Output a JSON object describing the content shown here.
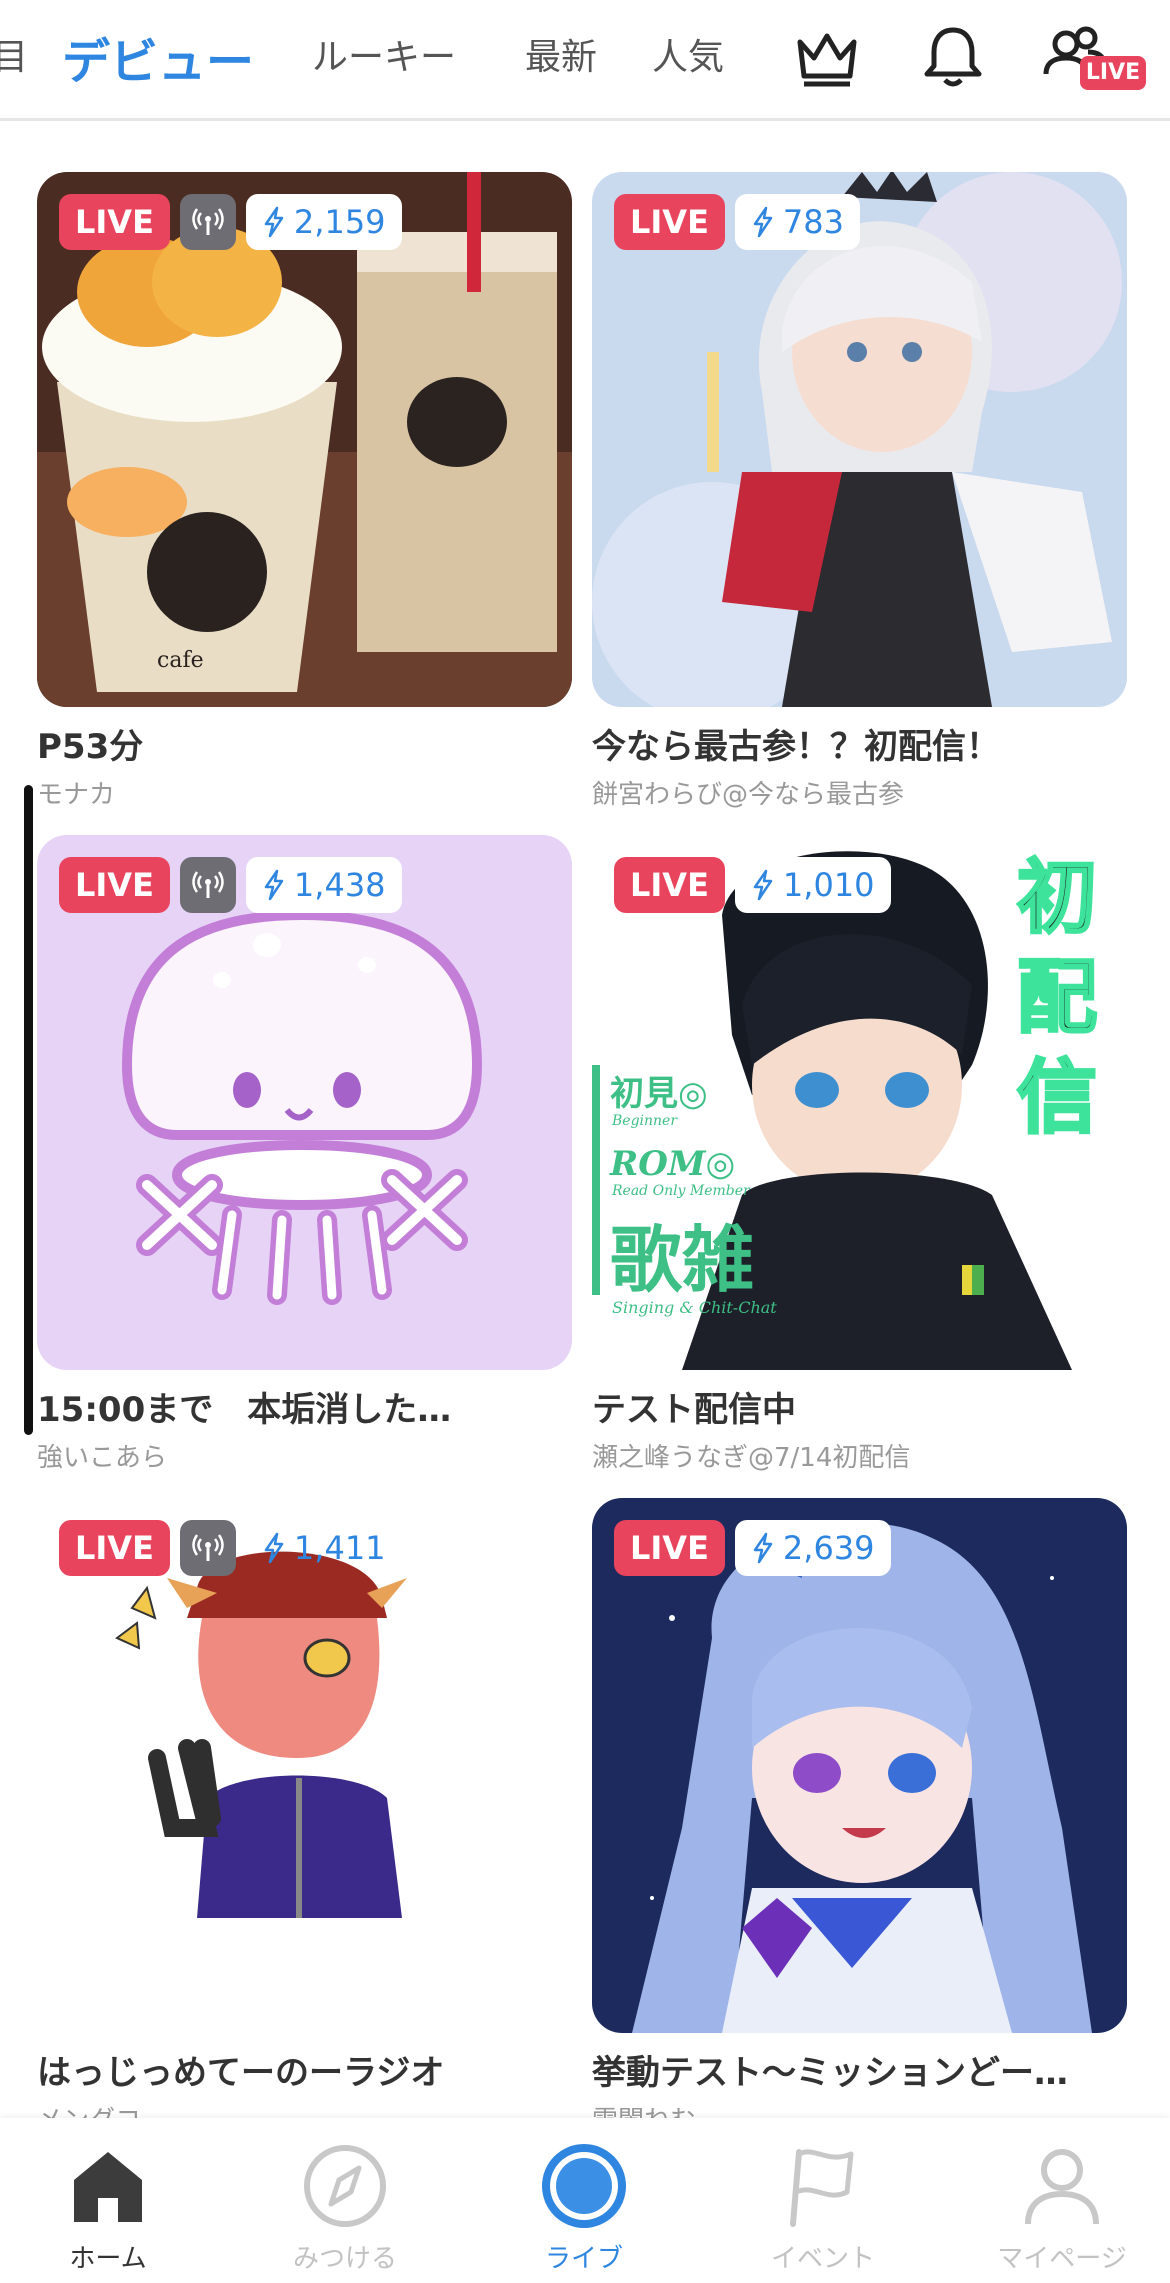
{
  "tabs": [
    {
      "label": "目"
    },
    {
      "label": "デビュー",
      "active": true
    },
    {
      "label": "ルーキー"
    },
    {
      "label": "最新"
    },
    {
      "label": "人気"
    }
  ],
  "header_icons": [
    "crown-icon",
    "bell-icon",
    "people-icon"
  ],
  "header_live_badge": "LIVE",
  "accent_color": "#2f86e0",
  "live_color": "#e9445d",
  "cards": [
    {
      "live": "LIVE",
      "radio": true,
      "count": "2,159",
      "title": "P53分",
      "streamer": "モナカ"
    },
    {
      "live": "LIVE",
      "radio": false,
      "count": "783",
      "title": "今なら最古参！？初配信！",
      "streamer": "餅宮わらび@今なら最古参"
    },
    {
      "live": "LIVE",
      "radio": true,
      "count": "1,438",
      "title": "15:00まで　本垢消した…",
      "streamer": "強いこあら"
    },
    {
      "live": "LIVE",
      "radio": false,
      "count": "1,010",
      "title": "テスト配信中",
      "streamer": "瀬之峰うなぎ@7/14初配信"
    },
    {
      "live": "LIVE",
      "radio": true,
      "count": "1,411",
      "title": "はっじっめてーのーラジオ",
      "streamer": "メンダコ"
    },
    {
      "live": "LIVE",
      "radio": false,
      "count": "2,639",
      "title": "挙動テスト〜ミッションどー…",
      "streamer": "雪闇ねむ"
    }
  ],
  "thumb4_text": {
    "vertical": "初配信",
    "lines": [
      "初見◎",
      "ROM◎",
      "歌雑"
    ],
    "sublines": [
      "Beginner",
      "Read Only Member",
      "Singing & Chit-Chat"
    ]
  },
  "thumb1_text": "cafe",
  "bottom_nav": [
    {
      "label": "ホーム",
      "icon": "home-icon"
    },
    {
      "label": "みつける",
      "icon": "compass-icon"
    },
    {
      "label": "ライブ",
      "icon": "live-circle-icon"
    },
    {
      "label": "イベント",
      "icon": "flag-icon"
    },
    {
      "label": "マイページ",
      "icon": "person-icon"
    }
  ]
}
